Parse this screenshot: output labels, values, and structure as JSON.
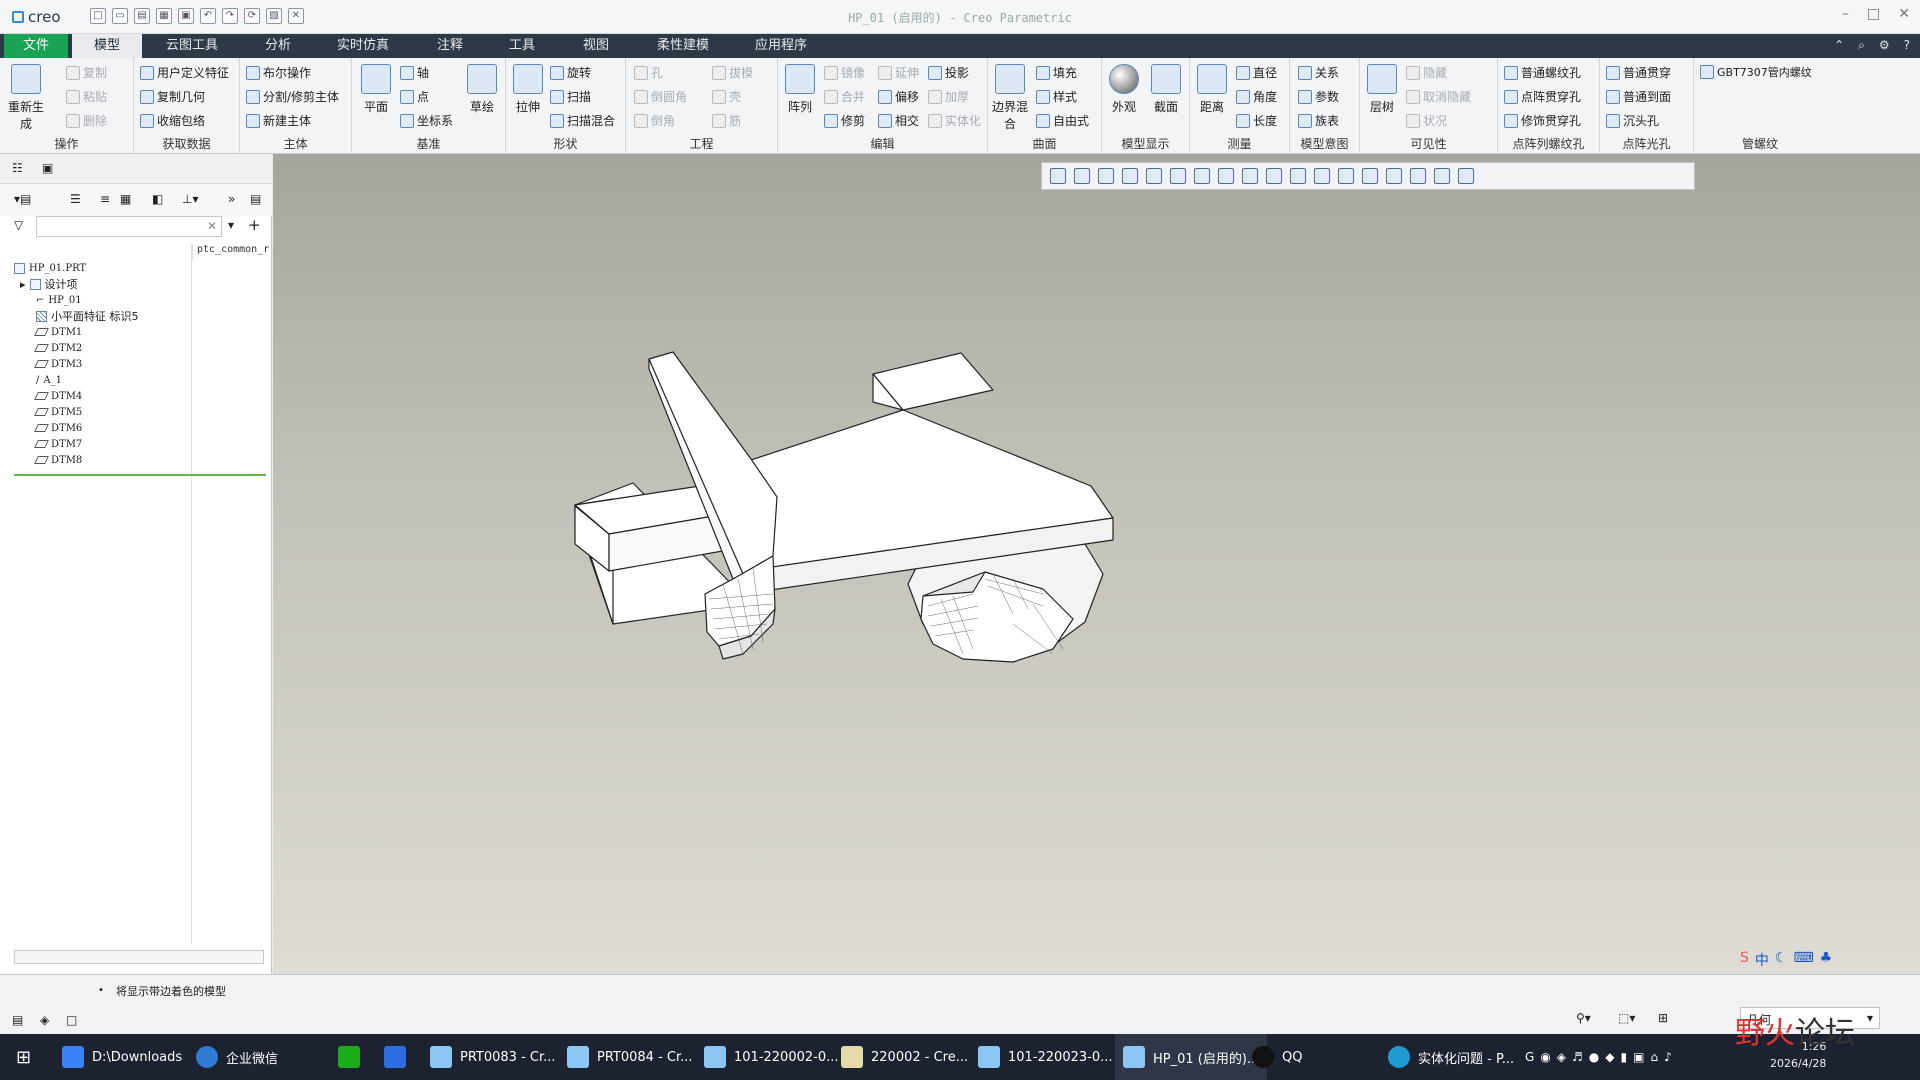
{
  "window": {
    "app": "creo",
    "title": "HP_01 (启用的) - Creo Parametric"
  },
  "menu": [
    "文件",
    "模型",
    "云图工具",
    "分析",
    "实时仿真",
    "注释",
    "工具",
    "视图",
    "柔性建模",
    "应用程序"
  ],
  "ribbon": {
    "ops": {
      "regen": "重新生成",
      "copy": "复制",
      "paste": "粘贴",
      "del": "删除",
      "label": "操作"
    },
    "get": {
      "a": "用户定义特征",
      "b": "复制几何",
      "c": "收缩包络",
      "label": "获取数据"
    },
    "body": {
      "a": "布尔操作",
      "b": "分割/修剪主体",
      "c": "新建主体",
      "label": "主体"
    },
    "datum": {
      "plane": "平面",
      "axis": "轴",
      "point": "点",
      "csys": "坐标系",
      "sketch": "草绘",
      "label": "基准"
    },
    "shape": {
      "extrude": "拉伸",
      "revolve": "旋转",
      "sweep": "扫描",
      "blend": "扫描混合",
      "label": "形状"
    },
    "eng": {
      "hole": "孔",
      "round": "倒圆角",
      "chamfer": "倒角",
      "draft": "拔模",
      "shell": "壳",
      "rib": "筋",
      "label": "工程"
    },
    "edit": {
      "pattern": "阵列",
      "mirror": "镜像",
      "merge": "合并",
      "trim": "修剪",
      "extend": "延伸",
      "offset": "偏移",
      "intersect": "相交",
      "project": "投影",
      "thicken": "加厚",
      "solidify": "实体化",
      "label": "编辑"
    },
    "surf": {
      "boundary": "边界混合",
      "fill": "填充",
      "style": "样式",
      "freestyle": "自由式",
      "label": "曲面"
    },
    "disp": {
      "appearance": "外观",
      "section": "截面",
      "label": "模型显示"
    },
    "measure": {
      "distance": "距离",
      "diameter": "直径",
      "angle": "角度",
      "length": "长度",
      "label": "测量"
    },
    "intent": {
      "relations": "关系",
      "params": "参数",
      "family": "族表",
      "label": "模型意图"
    },
    "vis": {
      "layer": "层树",
      "hide": "隐藏",
      "unhide": "取消隐藏",
      "status": "状况",
      "label": "可见性"
    },
    "ph": {
      "a": "普通螺纹孔",
      "b": "点阵贯穿孔",
      "c": "修饰贯穿孔",
      "label": "点阵列螺纹孔"
    },
    "lh": {
      "a": "普通贯穿",
      "b": "普通到面",
      "c": "沉头孔",
      "label": "点阵光孔"
    },
    "pipe": {
      "a": "GBT7307管内螺纹",
      "label": "管螺纹"
    }
  },
  "tree": {
    "column": "ptc_common_r",
    "items": [
      "HP_01.PRT",
      "设计项",
      "HP_01",
      "小平面特征 标识5",
      "DTM1",
      "DTM2",
      "DTM3",
      "A_1",
      "DTM4",
      "DTM5",
      "DTM6",
      "DTM7",
      "DTM8"
    ]
  },
  "status": {
    "message": "将显示带边着色的模型",
    "filter": "几何"
  },
  "taskbar": [
    "D:\\Downloads",
    "企业微信",
    "PRT0083 - Cr...",
    "PRT0084 - Cr...",
    "101-220002-0...",
    "220002 - Cre...",
    "101-220023-0...",
    "HP_01 (启用的)...",
    "QQ",
    "实体化问题 - P..."
  ],
  "tray": {
    "time": "1:26",
    "date": "2026/4/28"
  },
  "watermark": {
    "a": "野火",
    "b": "论坛"
  }
}
